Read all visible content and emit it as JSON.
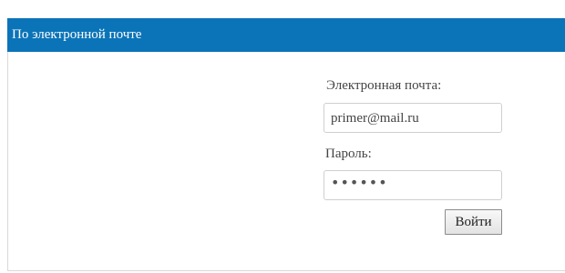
{
  "panel": {
    "title": "По электронной почте"
  },
  "form": {
    "email_label": "Электронная почта:",
    "email_value": "primer@mail.ru",
    "password_label": "Пароль:",
    "password_value": "••••••",
    "submit_label": "Войти"
  },
  "colors": {
    "header_background": "#0b74b8",
    "header_text": "#ffffff",
    "border": "#d9d9d9"
  }
}
